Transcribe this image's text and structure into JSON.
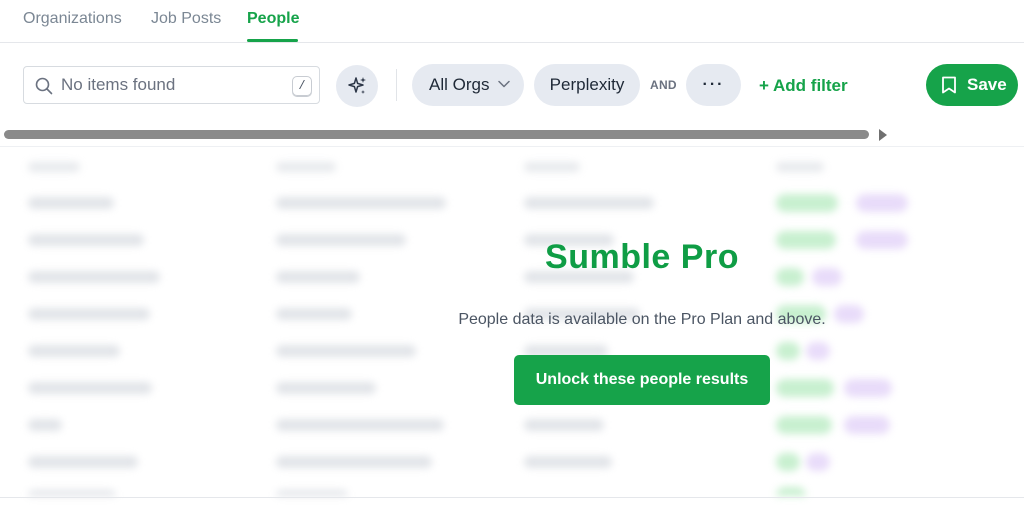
{
  "tabs": [
    {
      "label": "Organizations",
      "active": false
    },
    {
      "label": "Job Posts",
      "active": false
    },
    {
      "label": "People",
      "active": true
    }
  ],
  "toolbar": {
    "search_placeholder": "No items found",
    "search_value": "",
    "shortcut_key": "/",
    "ai_icon": "sparkles-icon",
    "org_filter_label": "All Orgs",
    "org_filter_icon": "chevron-down-icon",
    "company_filter_label": "Perplexity",
    "and_label": "AND",
    "more_label": "···",
    "add_filter_label": "+ Add filter",
    "save_label": "Save",
    "save_icon": "bookmark-icon"
  },
  "paywall": {
    "title": "Sumble Pro",
    "description": "People data is available on the Pro Plan and above.",
    "button_label": "Unlock these people results"
  },
  "colors": {
    "accent": "#16a34a",
    "pill_background": "#e6eaf1",
    "title_green": "#0f9d45"
  }
}
